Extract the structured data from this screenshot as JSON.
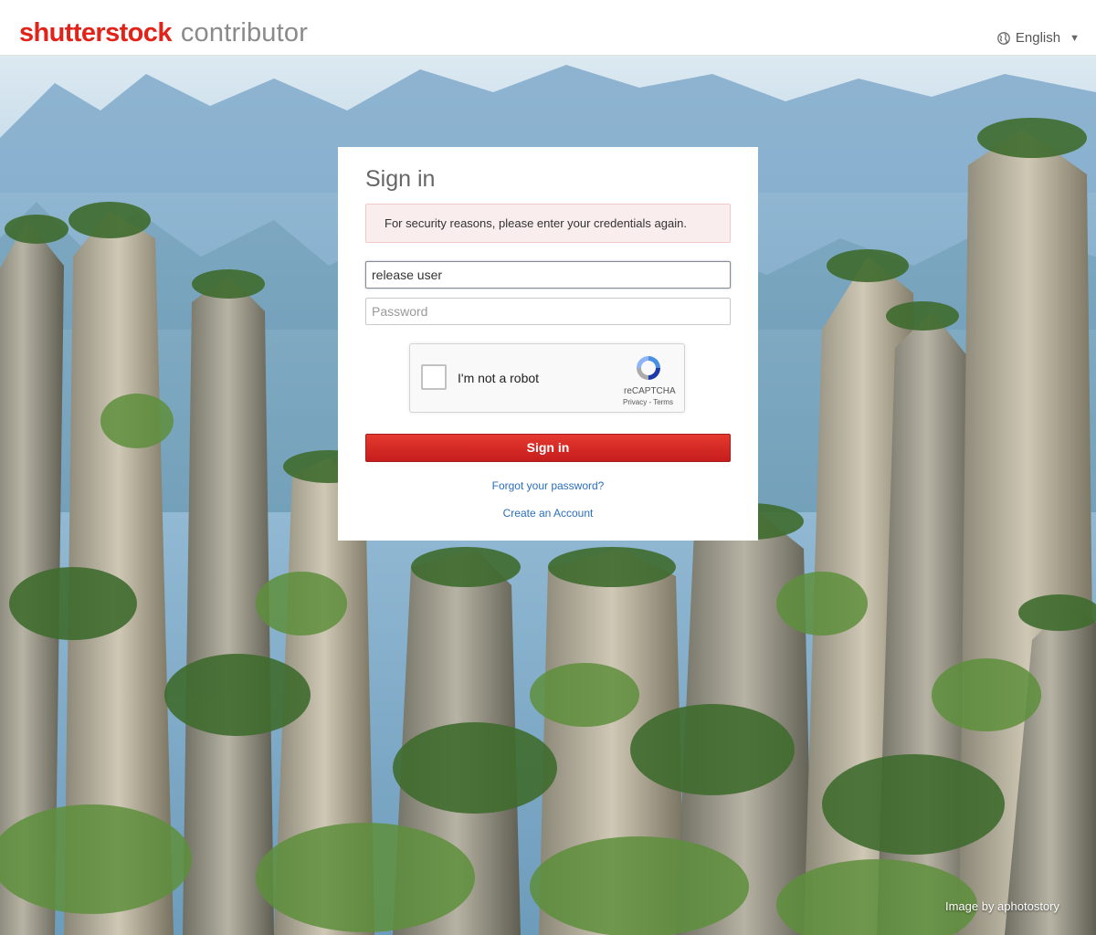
{
  "header": {
    "brand": "shutterstock",
    "product": "contributor",
    "language": "English"
  },
  "signin": {
    "title": "Sign in",
    "alert": "For security reasons, please enter your credentials again.",
    "username_value": "release user",
    "password_placeholder": "Password",
    "captcha_label": "I'm not a robot",
    "captcha_brand": "reCAPTCHA",
    "captcha_links": "Privacy - Terms",
    "submit": "Sign in",
    "forgot": "Forgot your password?",
    "create": "Create an Account"
  },
  "background": {
    "credit": "Image by aphotostory"
  },
  "colors": {
    "brand_red": "#e2231a",
    "button_red": "#c61d1d",
    "link_blue": "#2a6ebb",
    "alert_bg": "#f9eded"
  }
}
